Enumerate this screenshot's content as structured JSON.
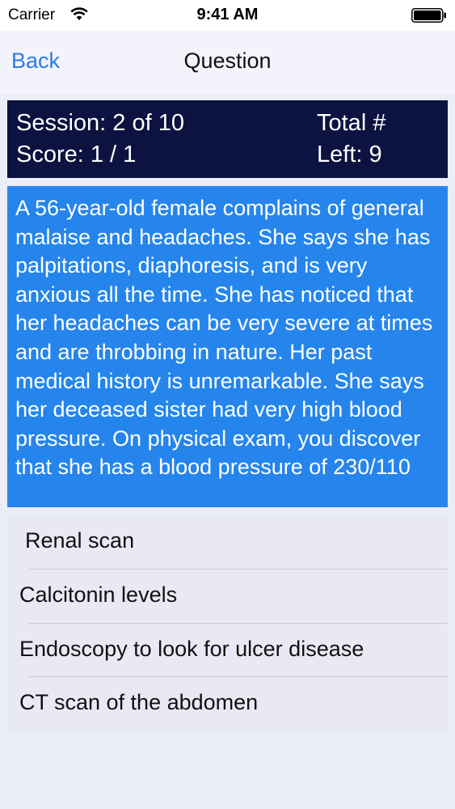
{
  "status_bar": {
    "carrier": "Carrier",
    "time": "9:41 AM"
  },
  "nav": {
    "back_label": "Back",
    "title": "Question"
  },
  "score_panel": {
    "session": "Session: 2 of 10",
    "score": "Score: 1 / 1",
    "total": "Total #",
    "left": "Left: 9"
  },
  "question": {
    "text": "A 56-year-old female complains of general malaise and headaches. She says she has palpitations, diaphoresis, and is very anxious all the time. She has noticed that her headaches can be very severe at times and are throbbing in nature. Her past medical history is unremarkable. She says her deceased sister had very high blood pressure. On physical exam, you discover that she has a blood pressure of 230/110"
  },
  "answers": [
    {
      "label": "Renal scan"
    },
    {
      "label": "Calcitonin levels"
    },
    {
      "label": "Endoscopy to look for ulcer disease"
    },
    {
      "label": "CT scan of the abdomen"
    }
  ],
  "colors": {
    "accent": "#2a7be8",
    "score_panel_bg": "#0c1340",
    "question_bg": "#2585ec",
    "answers_bg": "#e8e9f4",
    "page_bg": "#ebedf8"
  },
  "icons": [
    "wifi-icon",
    "battery-icon"
  ]
}
